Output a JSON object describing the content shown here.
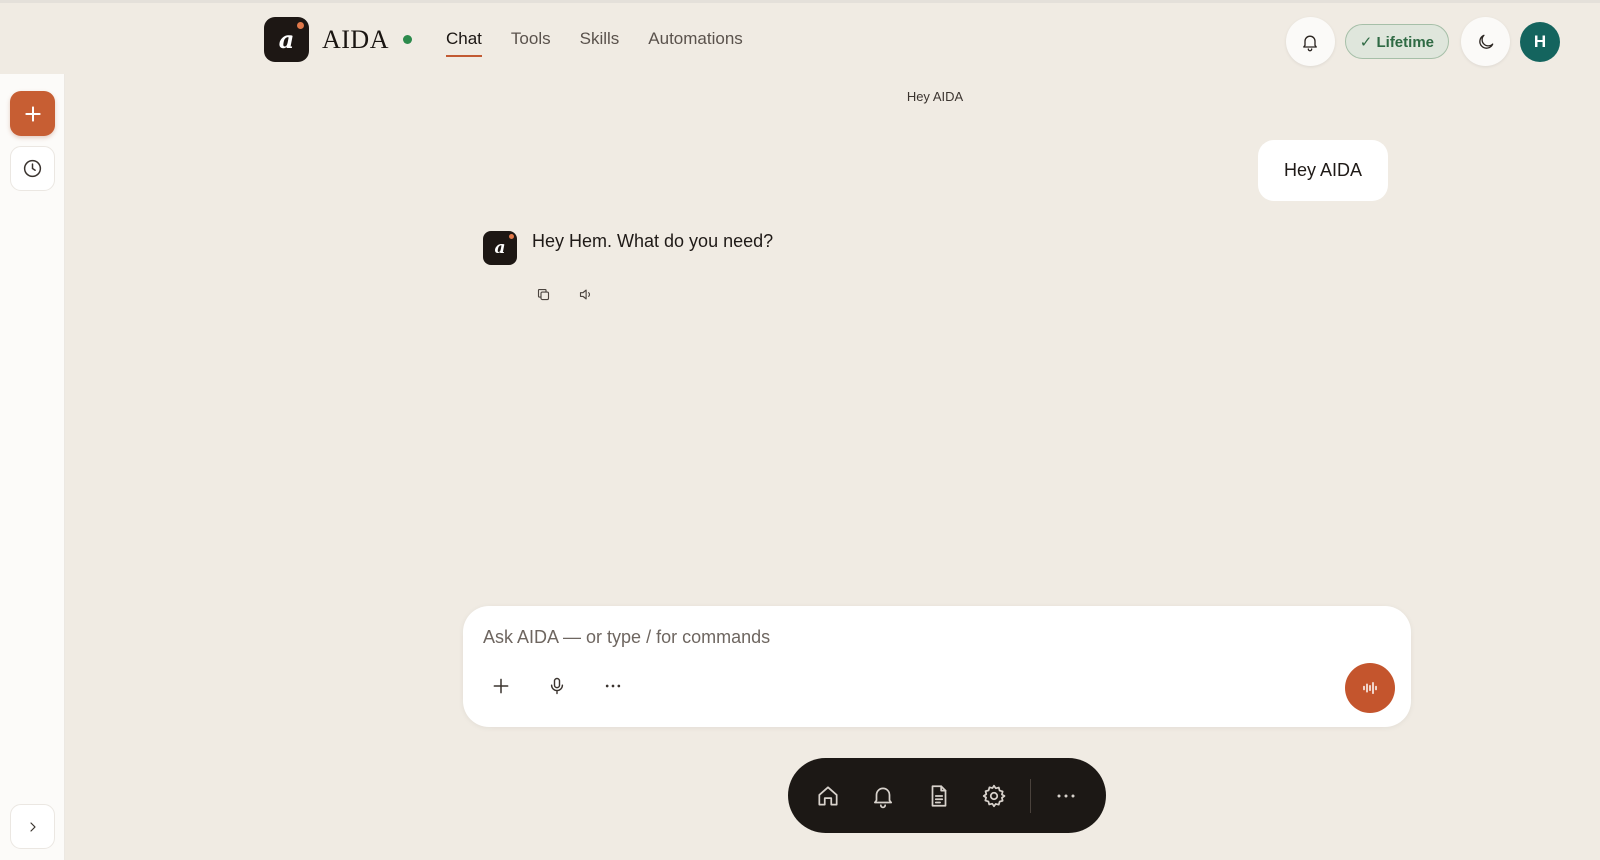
{
  "app": {
    "brand_name": "AIDA",
    "logo_letter": "a",
    "colors": {
      "accent": "#c75e33",
      "online": "#2c8a4c",
      "avatar_bg": "#14645e",
      "lifetime_text": "#2f6a44"
    }
  },
  "nav": {
    "tabs": [
      {
        "label": "Chat",
        "active": true
      },
      {
        "label": "Tools",
        "active": false
      },
      {
        "label": "Skills",
        "active": false
      },
      {
        "label": "Automations",
        "active": false
      }
    ]
  },
  "header": {
    "lifetime_badge": "✓ Lifetime",
    "user_initial": "H",
    "icons": [
      "bell-icon",
      "moon-icon"
    ]
  },
  "sidebar": {
    "new_label": "+",
    "icons": [
      "plus-icon",
      "clock-icon",
      "chevron-right-icon"
    ]
  },
  "chat": {
    "title": "Hey AIDA",
    "messages": [
      {
        "role": "user",
        "text": "Hey AIDA"
      },
      {
        "role": "assistant",
        "text": "Hey Hem. What do you need?"
      }
    ],
    "message_actions": [
      "copy-icon",
      "speaker-icon"
    ]
  },
  "composer": {
    "placeholder": "Ask AIDA — or type / for commands",
    "value": "",
    "tools": [
      "plus-icon",
      "microphone-icon",
      "more-icon"
    ],
    "send_icon": "waveform-icon"
  },
  "dock": {
    "icons": [
      "home-icon",
      "bell-icon",
      "document-icon",
      "gear-icon",
      "more-icon"
    ]
  }
}
